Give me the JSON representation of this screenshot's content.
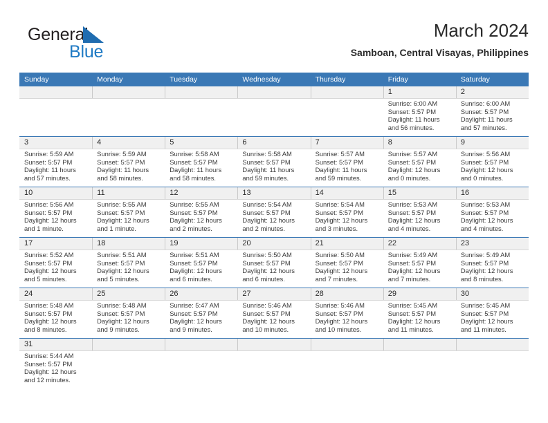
{
  "brand": {
    "name_top": "General",
    "name_bottom": "Blue",
    "flag_icon": "triangle-flag-icon",
    "color_top": "#231f20",
    "color_bottom": "#1f7ac4"
  },
  "header": {
    "title": "March 2024",
    "subtitle": "Samboan, Central Visayas, Philippines"
  },
  "calendar": {
    "header_bg": "#3a78b5",
    "datestrip_bg": "#f0f0f0",
    "weekdays": [
      "Sunday",
      "Monday",
      "Tuesday",
      "Wednesday",
      "Thursday",
      "Friday",
      "Saturday"
    ],
    "weeks": [
      [
        {
          "day": "",
          "lines": []
        },
        {
          "day": "",
          "lines": []
        },
        {
          "day": "",
          "lines": []
        },
        {
          "day": "",
          "lines": []
        },
        {
          "day": "",
          "lines": []
        },
        {
          "day": "1",
          "lines": [
            "Sunrise: 6:00 AM",
            "Sunset: 5:57 PM",
            "Daylight: 11 hours",
            "and 56 minutes."
          ]
        },
        {
          "day": "2",
          "lines": [
            "Sunrise: 6:00 AM",
            "Sunset: 5:57 PM",
            "Daylight: 11 hours",
            "and 57 minutes."
          ]
        }
      ],
      [
        {
          "day": "3",
          "lines": [
            "Sunrise: 5:59 AM",
            "Sunset: 5:57 PM",
            "Daylight: 11 hours",
            "and 57 minutes."
          ]
        },
        {
          "day": "4",
          "lines": [
            "Sunrise: 5:59 AM",
            "Sunset: 5:57 PM",
            "Daylight: 11 hours",
            "and 58 minutes."
          ]
        },
        {
          "day": "5",
          "lines": [
            "Sunrise: 5:58 AM",
            "Sunset: 5:57 PM",
            "Daylight: 11 hours",
            "and 58 minutes."
          ]
        },
        {
          "day": "6",
          "lines": [
            "Sunrise: 5:58 AM",
            "Sunset: 5:57 PM",
            "Daylight: 11 hours",
            "and 59 minutes."
          ]
        },
        {
          "day": "7",
          "lines": [
            "Sunrise: 5:57 AM",
            "Sunset: 5:57 PM",
            "Daylight: 11 hours",
            "and 59 minutes."
          ]
        },
        {
          "day": "8",
          "lines": [
            "Sunrise: 5:57 AM",
            "Sunset: 5:57 PM",
            "Daylight: 12 hours",
            "and 0 minutes."
          ]
        },
        {
          "day": "9",
          "lines": [
            "Sunrise: 5:56 AM",
            "Sunset: 5:57 PM",
            "Daylight: 12 hours",
            "and 0 minutes."
          ]
        }
      ],
      [
        {
          "day": "10",
          "lines": [
            "Sunrise: 5:56 AM",
            "Sunset: 5:57 PM",
            "Daylight: 12 hours",
            "and 1 minute."
          ]
        },
        {
          "day": "11",
          "lines": [
            "Sunrise: 5:55 AM",
            "Sunset: 5:57 PM",
            "Daylight: 12 hours",
            "and 1 minute."
          ]
        },
        {
          "day": "12",
          "lines": [
            "Sunrise: 5:55 AM",
            "Sunset: 5:57 PM",
            "Daylight: 12 hours",
            "and 2 minutes."
          ]
        },
        {
          "day": "13",
          "lines": [
            "Sunrise: 5:54 AM",
            "Sunset: 5:57 PM",
            "Daylight: 12 hours",
            "and 2 minutes."
          ]
        },
        {
          "day": "14",
          "lines": [
            "Sunrise: 5:54 AM",
            "Sunset: 5:57 PM",
            "Daylight: 12 hours",
            "and 3 minutes."
          ]
        },
        {
          "day": "15",
          "lines": [
            "Sunrise: 5:53 AM",
            "Sunset: 5:57 PM",
            "Daylight: 12 hours",
            "and 4 minutes."
          ]
        },
        {
          "day": "16",
          "lines": [
            "Sunrise: 5:53 AM",
            "Sunset: 5:57 PM",
            "Daylight: 12 hours",
            "and 4 minutes."
          ]
        }
      ],
      [
        {
          "day": "17",
          "lines": [
            "Sunrise: 5:52 AM",
            "Sunset: 5:57 PM",
            "Daylight: 12 hours",
            "and 5 minutes."
          ]
        },
        {
          "day": "18",
          "lines": [
            "Sunrise: 5:51 AM",
            "Sunset: 5:57 PM",
            "Daylight: 12 hours",
            "and 5 minutes."
          ]
        },
        {
          "day": "19",
          "lines": [
            "Sunrise: 5:51 AM",
            "Sunset: 5:57 PM",
            "Daylight: 12 hours",
            "and 6 minutes."
          ]
        },
        {
          "day": "20",
          "lines": [
            "Sunrise: 5:50 AM",
            "Sunset: 5:57 PM",
            "Daylight: 12 hours",
            "and 6 minutes."
          ]
        },
        {
          "day": "21",
          "lines": [
            "Sunrise: 5:50 AM",
            "Sunset: 5:57 PM",
            "Daylight: 12 hours",
            "and 7 minutes."
          ]
        },
        {
          "day": "22",
          "lines": [
            "Sunrise: 5:49 AM",
            "Sunset: 5:57 PM",
            "Daylight: 12 hours",
            "and 7 minutes."
          ]
        },
        {
          "day": "23",
          "lines": [
            "Sunrise: 5:49 AM",
            "Sunset: 5:57 PM",
            "Daylight: 12 hours",
            "and 8 minutes."
          ]
        }
      ],
      [
        {
          "day": "24",
          "lines": [
            "Sunrise: 5:48 AM",
            "Sunset: 5:57 PM",
            "Daylight: 12 hours",
            "and 8 minutes."
          ]
        },
        {
          "day": "25",
          "lines": [
            "Sunrise: 5:48 AM",
            "Sunset: 5:57 PM",
            "Daylight: 12 hours",
            "and 9 minutes."
          ]
        },
        {
          "day": "26",
          "lines": [
            "Sunrise: 5:47 AM",
            "Sunset: 5:57 PM",
            "Daylight: 12 hours",
            "and 9 minutes."
          ]
        },
        {
          "day": "27",
          "lines": [
            "Sunrise: 5:46 AM",
            "Sunset: 5:57 PM",
            "Daylight: 12 hours",
            "and 10 minutes."
          ]
        },
        {
          "day": "28",
          "lines": [
            "Sunrise: 5:46 AM",
            "Sunset: 5:57 PM",
            "Daylight: 12 hours",
            "and 10 minutes."
          ]
        },
        {
          "day": "29",
          "lines": [
            "Sunrise: 5:45 AM",
            "Sunset: 5:57 PM",
            "Daylight: 12 hours",
            "and 11 minutes."
          ]
        },
        {
          "day": "30",
          "lines": [
            "Sunrise: 5:45 AM",
            "Sunset: 5:57 PM",
            "Daylight: 12 hours",
            "and 11 minutes."
          ]
        }
      ],
      [
        {
          "day": "31",
          "lines": [
            "Sunrise: 5:44 AM",
            "Sunset: 5:57 PM",
            "Daylight: 12 hours",
            "and 12 minutes."
          ]
        },
        {
          "day": "",
          "lines": []
        },
        {
          "day": "",
          "lines": []
        },
        {
          "day": "",
          "lines": []
        },
        {
          "day": "",
          "lines": []
        },
        {
          "day": "",
          "lines": []
        },
        {
          "day": "",
          "lines": []
        }
      ]
    ]
  }
}
